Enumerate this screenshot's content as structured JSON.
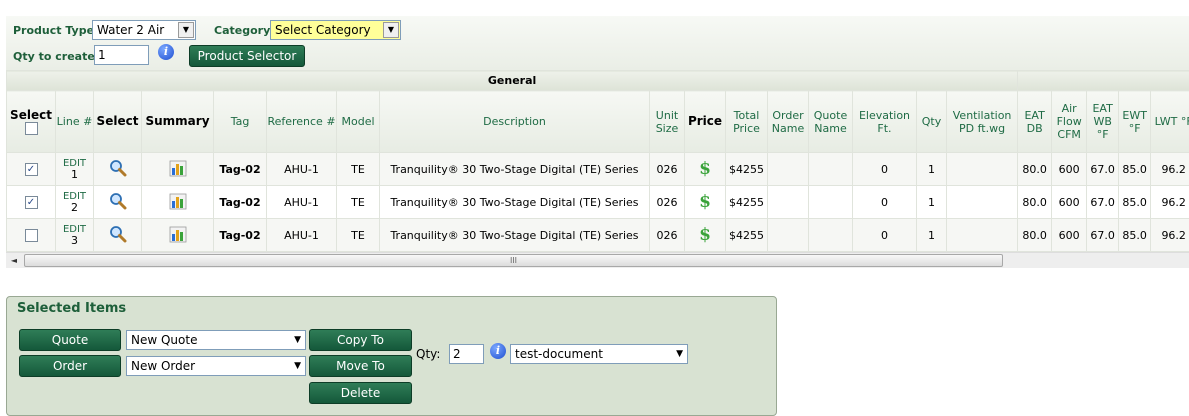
{
  "toolbar": {
    "product_type_label": "Product Type",
    "product_type_value": "Water 2 Air",
    "category_label": "Category",
    "category_value": "Select Category",
    "qty_label": "Qty to create",
    "qty_value": "1",
    "product_selector_label": "Product Selector"
  },
  "grid": {
    "group_header": "General",
    "columns": {
      "select_all": "Select",
      "line": "Line #",
      "select": "Select",
      "summary": "Summary",
      "tag": "Tag",
      "reference": "Reference #",
      "model": "Model",
      "description": "Description",
      "unit_size": "Unit Size",
      "price": "Price",
      "total_price": "Total Price",
      "order_name": "Order Name",
      "quote_name": "Quote Name",
      "elevation": "Elevation Ft.",
      "qty": "Qty",
      "ventilation": "Ventilation PD ft.wg",
      "eat_db": "EAT DB",
      "air_flow": "Air Flow CFM",
      "eat_wb": "EAT WB °F",
      "ewt": "EWT °F",
      "lwt": "LWT °F"
    },
    "rows": [
      {
        "checked": "✓",
        "edit": "EDIT",
        "line": "1",
        "tag": "Tag-02",
        "reference": "AHU-1",
        "model": "TE",
        "description": "Tranquility® 30 Two-Stage Digital (TE) Series",
        "unit_size": "026",
        "price_symbol": "$",
        "total_price": "$4255",
        "order_name": "",
        "quote_name": "",
        "elevation": "0",
        "qty": "1",
        "ventilation": "",
        "eat_db": "80.0",
        "air_flow": "600",
        "eat_wb": "67.0",
        "ewt": "85.0",
        "lwt": "96.2"
      },
      {
        "checked": "✓",
        "edit": "EDIT",
        "line": "2",
        "tag": "Tag-02",
        "reference": "AHU-1",
        "model": "TE",
        "description": "Tranquility® 30 Two-Stage Digital (TE) Series",
        "unit_size": "026",
        "price_symbol": "$",
        "total_price": "$4255",
        "order_name": "",
        "quote_name": "",
        "elevation": "0",
        "qty": "1",
        "ventilation": "",
        "eat_db": "80.0",
        "air_flow": "600",
        "eat_wb": "67.0",
        "ewt": "85.0",
        "lwt": "96.2"
      },
      {
        "checked": "",
        "edit": "EDIT",
        "line": "3",
        "tag": "Tag-02",
        "reference": "AHU-1",
        "model": "TE",
        "description": "Tranquility® 30 Two-Stage Digital (TE) Series",
        "unit_size": "026",
        "price_symbol": "$",
        "total_price": "$4255",
        "order_name": "",
        "quote_name": "",
        "elevation": "0",
        "qty": "1",
        "ventilation": "",
        "eat_db": "80.0",
        "air_flow": "600",
        "eat_wb": "67.0",
        "ewt": "85.0",
        "lwt": "96.2"
      }
    ],
    "scroll_grip": "III"
  },
  "selected_items": {
    "title": "Selected Items",
    "quote_button": "Quote",
    "quote_select": "New Quote",
    "order_button": "Order",
    "order_select": "New Order",
    "copy_to_button": "Copy To",
    "move_to_button": "Move To",
    "delete_button": "Delete",
    "qty_label": "Qty:",
    "qty_value": "2",
    "document_select": "test-document"
  },
  "icons": {
    "info": "info-icon",
    "magnifier": "magnifier-icon",
    "summary": "summary-chart-icon",
    "dollar": "dollar-icon",
    "dropdown": "chevron-down-icon"
  },
  "colors": {
    "accent_green": "#1e5f3a",
    "button_green": "#1f6b45",
    "category_highlight": "#ffff99",
    "panel_bg": "#d8e2d2"
  }
}
